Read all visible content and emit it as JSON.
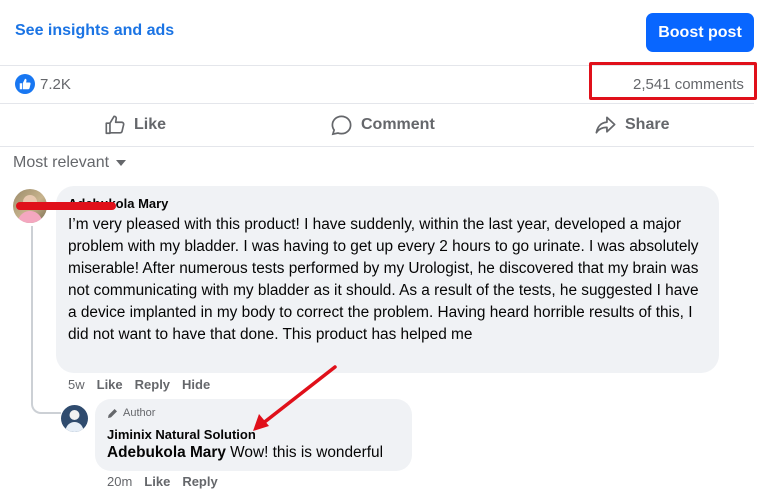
{
  "header": {
    "insights_link": "See insights and ads",
    "boost_button": "Boost post"
  },
  "reactions": {
    "count": "7.2K",
    "comments_count": "2,541 comments"
  },
  "actions": {
    "like": "Like",
    "comment": "Comment",
    "share": "Share"
  },
  "sort": {
    "label": "Most relevant"
  },
  "comment": {
    "author": "Adebukola Mary",
    "text": "I’m very pleased with this product! I have suddenly, within the last year, developed a major problem with my bladder. I was having to get up every 2 hours to go urinate. I was absolutely miserable! After numerous tests performed by my Urologist, he discovered that my brain was not communicating with my bladder as it should. As a result of the tests, he suggested I have a device implanted in my body to correct the problem. Having heard horrible results of this, I did not want to have that done. This product has helped me",
    "time": "5w",
    "like": "Like",
    "reply": "Reply",
    "hide": "Hide"
  },
  "reply": {
    "badge": "Author",
    "author": "Jiminix Natural Solution",
    "mention": "Adebukola Mary",
    "text": " Wow! this is wonderful",
    "time": "20m",
    "like": "Like",
    "reply": "Reply"
  },
  "colors": {
    "accent": "#1b74e4",
    "boost": "#0866ff",
    "annotation_red": "#e0101a"
  }
}
